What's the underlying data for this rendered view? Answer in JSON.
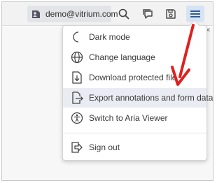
{
  "header": {
    "user_email": "demo@vitrium.com"
  },
  "menu": {
    "items": [
      {
        "label": "Dark mode",
        "icon": "moon-icon"
      },
      {
        "label": "Change language",
        "icon": "globe-icon"
      },
      {
        "label": "Download protected file",
        "icon": "file-download-icon"
      },
      {
        "label": "Export annotations and form data",
        "icon": "export-icon",
        "highlighted": true
      },
      {
        "label": "Switch to Aria Viewer",
        "icon": "accessibility-icon"
      },
      {
        "label": "Sign out",
        "icon": "sign-out-icon"
      }
    ]
  },
  "colors": {
    "accent": "#2f5d95",
    "annotation_arrow": "#e0201e",
    "highlight": "#e9ecf2"
  }
}
